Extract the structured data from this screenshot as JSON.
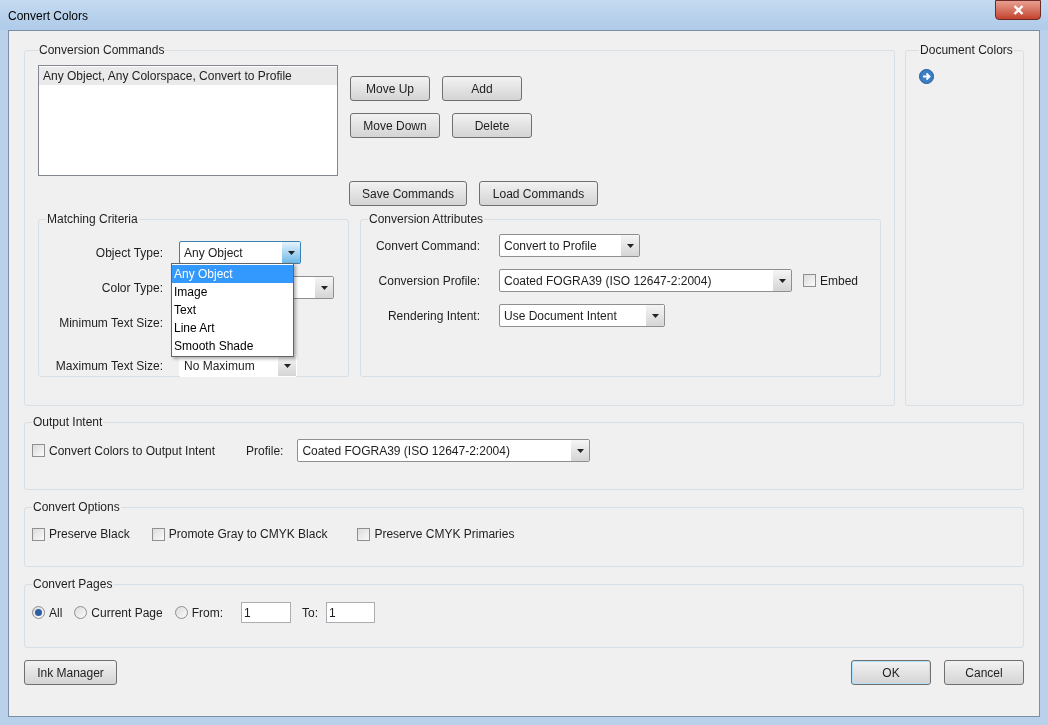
{
  "window": {
    "title": "Convert Colors"
  },
  "conversion_commands": {
    "title": "Conversion Commands",
    "list": [
      {
        "text": "Any Object, Any Colorspace, Convert to Profile",
        "selected": true
      }
    ],
    "buttons": [
      "Move Up",
      "Add",
      "Move Down",
      "Delete",
      "Save Commands",
      "Load Commands"
    ]
  },
  "matching_criteria": {
    "title": "Matching Criteria",
    "fields": [
      {
        "label": "Object Type:",
        "value": "Any Object",
        "expanded": true
      },
      {
        "label": "Color Type:"
      },
      {
        "label": "Minimum Text Size:"
      },
      {
        "label": "Maximum Text Size:",
        "value": "No Maximum"
      }
    ],
    "dropdown_options": [
      {
        "label": "Any Object",
        "selected": true
      },
      {
        "label": "Image",
        "selected": false
      },
      {
        "label": "Text",
        "selected": false
      },
      {
        "label": "Line Art",
        "selected": false
      },
      {
        "label": "Smooth Shade",
        "selected": false
      }
    ]
  },
  "conversion_attributes": {
    "title": "Conversion Attributes",
    "fields": [
      {
        "label": "Convert Command:",
        "value": "Convert to Profile"
      },
      {
        "label": "Conversion Profile:",
        "value": "Coated FOGRA39 (ISO 12647-2:2004)",
        "embed": {
          "label": "Embed",
          "checked": false
        }
      },
      {
        "label": "Rendering Intent:",
        "value": "Use Document Intent"
      }
    ]
  },
  "document_colors": {
    "title": "Document Colors"
  },
  "output_intent": {
    "title": "Output Intent",
    "checkbox": {
      "label": "Convert Colors to Output Intent",
      "checked": false
    },
    "profile_label": "Profile:",
    "profile": "Coated FOGRA39 (ISO 12647-2:2004)"
  },
  "convert_options": {
    "title": "Convert Options",
    "checkboxes": [
      {
        "label": "Preserve Black",
        "checked": false
      },
      {
        "label": "Promote Gray to CMYK Black",
        "checked": false
      },
      {
        "label": "Preserve CMYK Primaries",
        "checked": false
      }
    ]
  },
  "convert_pages": {
    "title": "Convert Pages",
    "radios": [
      {
        "label": "All",
        "selected": true
      },
      {
        "label": "Current Page",
        "selected": false
      },
      {
        "label": "From:",
        "selected": false
      }
    ],
    "from": "1",
    "to_label": "To:",
    "to": "1"
  },
  "footer": {
    "left_button": "Ink Manager",
    "buttons": [
      {
        "label": "OK",
        "default": true
      },
      {
        "label": "Cancel",
        "default": false
      }
    ]
  }
}
